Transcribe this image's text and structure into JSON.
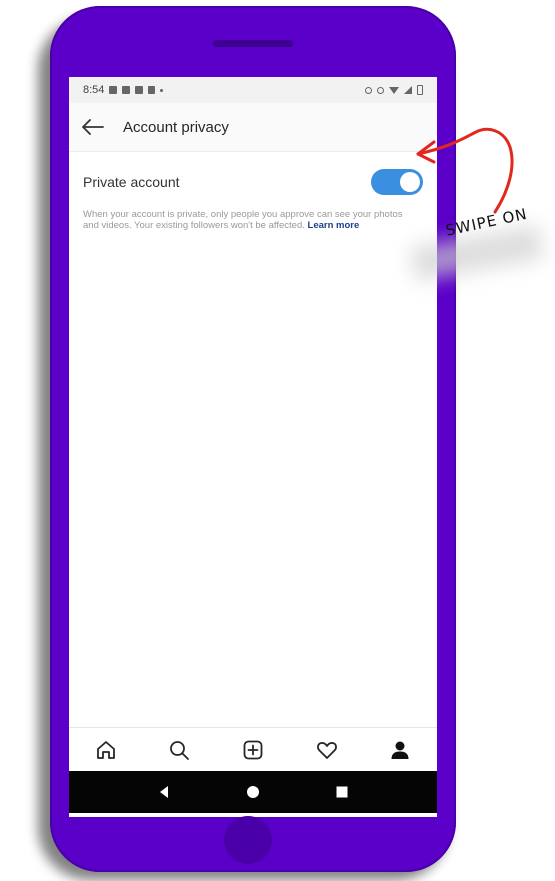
{
  "status_bar": {
    "time": "8:54"
  },
  "header": {
    "title": "Account privacy"
  },
  "setting": {
    "label": "Private account",
    "toggle_state": "on"
  },
  "description": {
    "text": "When your account is private, only people you approve can see your photos and videos. Your existing followers won't be affected.",
    "link": "Learn more"
  },
  "bottom_tabs": [
    {
      "icon": "home-icon"
    },
    {
      "icon": "search-icon"
    },
    {
      "icon": "add-post-icon"
    },
    {
      "icon": "heart-icon"
    },
    {
      "icon": "profile-icon"
    }
  ],
  "annotation": {
    "text": "SWIPE ON"
  },
  "colors": {
    "phone": "#5a00c8",
    "toggle": "#3a8fe0",
    "arrow": "#e0281e",
    "link": "#1d3f8a"
  }
}
